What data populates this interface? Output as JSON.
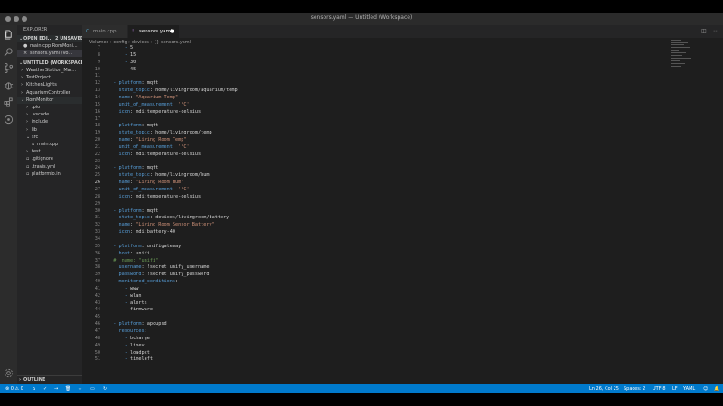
{
  "window": {
    "title": "sensors.yaml — Untitled (Workspace)"
  },
  "colors": {
    "accent": "#007acc",
    "key": "#569cd6",
    "string": "#ce9178",
    "comment": "#6a9955"
  },
  "activity": [
    "explorer-icon",
    "search-icon",
    "source-control-icon",
    "debug-icon",
    "extensions-icon",
    "platformio-icon",
    "gear-icon"
  ],
  "sidebar": {
    "header": "EXPLORER",
    "open_editors": "OPEN EDI...",
    "unsaved": "2 UNSAVED",
    "open_files": [
      "main.cpp  RomMoni...",
      "sensors.yaml  /Vo..."
    ],
    "workspace": "UNTITLED (WORKSPACE)",
    "items": [
      "WeatherStation_Mar...",
      "TestProject",
      "KitchenLights",
      "AquariumController",
      "RomMonitor",
      ".pio",
      ".vscode",
      "include",
      "lib",
      "src",
      "main.cpp",
      "test",
      ".gitignore",
      ".travis.yml",
      "platformio.ini"
    ],
    "outline": "OUTLINE"
  },
  "tabs": [
    {
      "label": "main.cpp"
    },
    {
      "label": "sensors.yaml"
    }
  ],
  "breadcrumb": "Volumes  ›  config  ›  devices  ›  {}  sensors.yaml",
  "code": [
    {
      "n": "7",
      "t": "      - 5"
    },
    {
      "n": "8",
      "t": "      - 15"
    },
    {
      "n": "9",
      "t": "      - 30"
    },
    {
      "n": "10",
      "t": "      - 45"
    },
    {
      "n": "11",
      "t": ""
    },
    {
      "n": "12",
      "t": "  - platform: mqtt"
    },
    {
      "n": "13",
      "t": "    state_topic: home/livingroom/aquarium/temp"
    },
    {
      "n": "14",
      "t": "    name: \"Aquarium Temp\""
    },
    {
      "n": "15",
      "t": "    unit_of_measurement: '°C'"
    },
    {
      "n": "16",
      "t": "    icon: mdi:temperature-celsius"
    },
    {
      "n": "17",
      "t": ""
    },
    {
      "n": "18",
      "t": "  - platform: mqtt"
    },
    {
      "n": "19",
      "t": "    state_topic: home/livingroom/temp"
    },
    {
      "n": "20",
      "t": "    name: \"Living Room Temp\""
    },
    {
      "n": "21",
      "t": "    unit_of_measurement: '°C'"
    },
    {
      "n": "22",
      "t": "    icon: mdi:temperature-celsius"
    },
    {
      "n": "23",
      "t": ""
    },
    {
      "n": "24",
      "t": "  - platform: mqtt"
    },
    {
      "n": "25",
      "t": "    state_topic: home/livingroom/hum"
    },
    {
      "n": "26",
      "t": "    name: \"Living Room Hum\""
    },
    {
      "n": "27",
      "t": "    unit_of_measurement: '°C'"
    },
    {
      "n": "28",
      "t": "    icon: mdi:temperature-celsius"
    },
    {
      "n": "29",
      "t": ""
    },
    {
      "n": "30",
      "t": "  - platform: mqtt"
    },
    {
      "n": "31",
      "t": "    state_topic: devices/livingroom/battery"
    },
    {
      "n": "32",
      "t": "    name: \"Living Room Sensor Battery\""
    },
    {
      "n": "33",
      "t": "    icon: mdi:battery-40"
    },
    {
      "n": "34",
      "t": ""
    },
    {
      "n": "35",
      "t": "  - platform: unifigateway"
    },
    {
      "n": "36",
      "t": "    host: unifi"
    },
    {
      "n": "37",
      "t": "  #  name: \"unifi\""
    },
    {
      "n": "38",
      "t": "    username: !secret unify_username"
    },
    {
      "n": "39",
      "t": "    password: !secret unify_password"
    },
    {
      "n": "40",
      "t": "    monitored_conditions:"
    },
    {
      "n": "41",
      "t": "      - www"
    },
    {
      "n": "42",
      "t": "      - wlan"
    },
    {
      "n": "43",
      "t": "      - alerts"
    },
    {
      "n": "44",
      "t": "      - firmware"
    },
    {
      "n": "45",
      "t": ""
    },
    {
      "n": "46",
      "t": "  - platform: apcupsd"
    },
    {
      "n": "47",
      "t": "    resources:"
    },
    {
      "n": "48",
      "t": "      - bcharge"
    },
    {
      "n": "49",
      "t": "      - linev"
    },
    {
      "n": "50",
      "t": "      - loadpct"
    },
    {
      "n": "51",
      "t": "      - timeleft"
    }
  ],
  "status": {
    "left": "⊗ 0  ⚠ 0",
    "position": "Ln 26, Col 25",
    "spaces": "Spaces: 2",
    "encoding": "UTF-8",
    "eol": "LF",
    "language": "YAML"
  }
}
